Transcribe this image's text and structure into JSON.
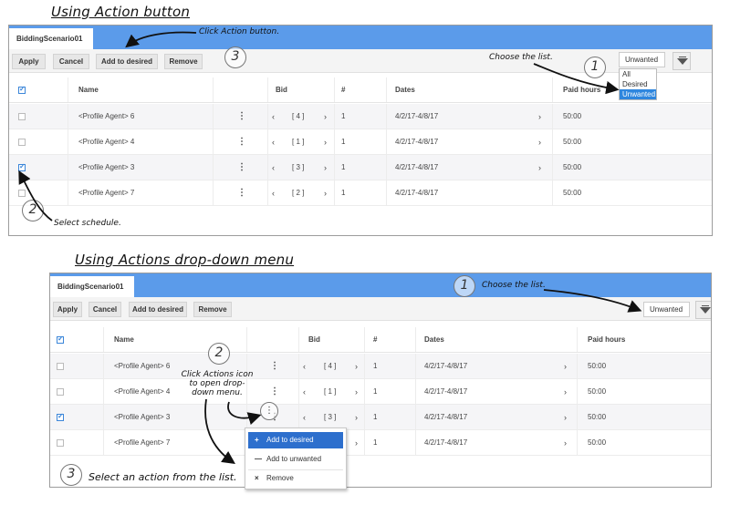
{
  "headings": {
    "top": "Using Action button",
    "bottom": "Using Actions drop-down menu"
  },
  "tab": {
    "label": "BiddingScenario01",
    "close_glyph": "«"
  },
  "toolbar": {
    "apply": "Apply",
    "cancel": "Cancel",
    "add_to_desired": "Add to desired",
    "remove": "Remove"
  },
  "list_select": {
    "value": "Unwanted",
    "options": [
      "All",
      "Desired",
      "Unwanted"
    ],
    "selected": "Unwanted"
  },
  "columns": {
    "name": "Name",
    "bid": "Bid",
    "number": "#",
    "dates": "Dates",
    "paid_hours": "Paid hours"
  },
  "rows": [
    {
      "name": "<Profile Agent> 6",
      "bid": "[ 4 ]",
      "number": "1",
      "dates": "4/2/17-4/8/17",
      "paid_hours": "50:00"
    },
    {
      "name": "<Profile Agent> 4",
      "bid": "[ 1 ]",
      "number": "1",
      "dates": "4/2/17-4/8/17",
      "paid_hours": "50:00"
    },
    {
      "name": "<Profile Agent> 3",
      "bid": "[ 3 ]",
      "number": "1",
      "dates": "4/2/17-4/8/17",
      "paid_hours": "50:00"
    },
    {
      "name": "<Profile Agent> 7",
      "bid": "[ 2 ]",
      "number": "1",
      "dates": "4/2/17-4/8/17",
      "paid_hours": "50:00"
    }
  ],
  "glyphs": {
    "prev": "‹",
    "next": "›",
    "kebab": "⋮",
    "plus": "+",
    "minus": "—",
    "cross": "×",
    "chevron": "›"
  },
  "actions_menu": {
    "add_desired": "Add to desired",
    "add_unwanted": "Add to unwanted",
    "remove": "Remove"
  },
  "callouts": {
    "top_click_action": "Click Action button.",
    "top_choose_list": "Choose the list.",
    "top_select_schedule": "Select schedule.",
    "bottom_choose_list": "Choose the list.",
    "bottom_click_icon_1": "Click Actions icon",
    "bottom_click_icon_2": "to open drop-",
    "bottom_click_icon_3": "down menu.",
    "bottom_select_action": "Select an action from the list."
  },
  "step_numbers": {
    "one": "1",
    "two": "2",
    "three": "3"
  },
  "colors": {
    "tab_bar": "#5b9bea",
    "selection": "#2e86de",
    "menu_highlight": "#2d6fcd"
  }
}
